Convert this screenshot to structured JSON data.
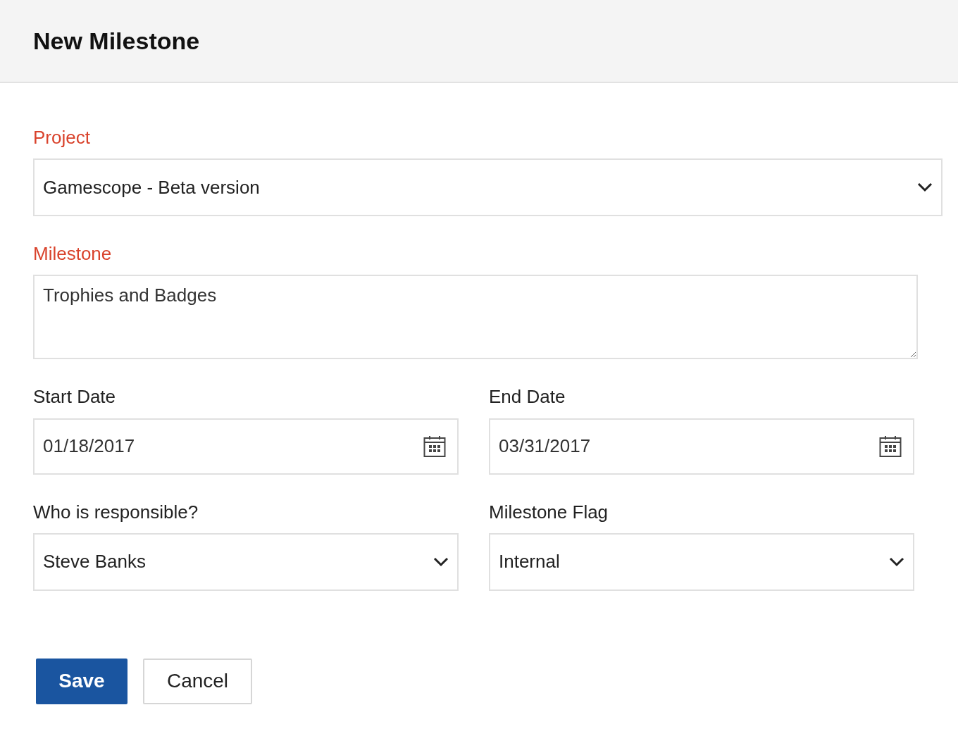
{
  "dialog": {
    "title": "New Milestone"
  },
  "rows": [
    [
      {
        "kind": "select",
        "label": "Project",
        "required": true,
        "value": "Gamescope - Beta version"
      }
    ],
    [
      {
        "kind": "textarea",
        "label": "Milestone",
        "required": true,
        "value": "Trophies and Badges"
      }
    ],
    [
      {
        "kind": "date",
        "label": "Start Date",
        "required": false,
        "value": "01/18/2017"
      },
      {
        "kind": "date",
        "label": "End Date",
        "required": false,
        "value": "03/31/2017"
      }
    ],
    [
      {
        "kind": "select",
        "label": "Who is responsible?",
        "required": false,
        "value": "Steve Banks"
      },
      {
        "kind": "select",
        "label": "Milestone Flag",
        "required": false,
        "value": "Internal"
      }
    ]
  ],
  "buttons": [
    {
      "kind": "primary",
      "label": "Save"
    },
    {
      "kind": "secondary",
      "label": "Cancel"
    }
  ]
}
